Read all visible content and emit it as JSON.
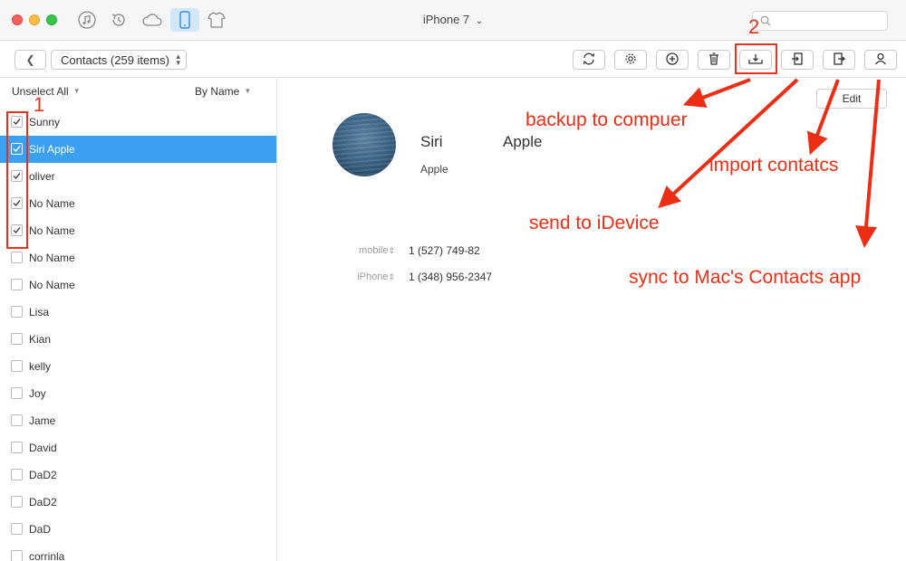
{
  "titlebar": {
    "device": "iPhone 7",
    "device_caret": "⌄",
    "search_placeholder": "",
    "icons": [
      "music-icon",
      "restore-icon",
      "cloud-icon",
      "phone-icon",
      "tshirt-icon"
    ]
  },
  "toolbar": {
    "back_glyph": "❮",
    "category": "Contacts (259 items)",
    "buttons": [
      "refresh-icon",
      "settings-icon",
      "add-icon",
      "delete-icon",
      "backup-to-computer-icon",
      "import-icon",
      "send-to-device-icon",
      "sync-contacts-icon"
    ]
  },
  "list": {
    "unselect_label": "Unselect All",
    "sort_label": "By Name",
    "items": [
      {
        "name": "Sunny",
        "checked": true,
        "selected": false
      },
      {
        "name": "Siri Apple",
        "checked": true,
        "selected": true
      },
      {
        "name": "oliver",
        "checked": true,
        "selected": false
      },
      {
        "name": "No Name",
        "checked": true,
        "selected": false
      },
      {
        "name": "No Name",
        "checked": true,
        "selected": false
      },
      {
        "name": "No Name",
        "checked": false,
        "selected": false
      },
      {
        "name": "No Name",
        "checked": false,
        "selected": false
      },
      {
        "name": "Lisa",
        "checked": false,
        "selected": false
      },
      {
        "name": "Kian",
        "checked": false,
        "selected": false
      },
      {
        "name": "kelly",
        "checked": false,
        "selected": false
      },
      {
        "name": "Joy",
        "checked": false,
        "selected": false
      },
      {
        "name": "Jame",
        "checked": false,
        "selected": false
      },
      {
        "name": "David",
        "checked": false,
        "selected": false
      },
      {
        "name": "DaD2",
        "checked": false,
        "selected": false
      },
      {
        "name": "DaD2",
        "checked": false,
        "selected": false
      },
      {
        "name": "DaD",
        "checked": false,
        "selected": false
      },
      {
        "name": "corrinla",
        "checked": false,
        "selected": false
      }
    ]
  },
  "detail": {
    "edit_label": "Edit",
    "first_name": "Siri",
    "last_name": "Apple",
    "company": "Apple",
    "phones": [
      {
        "label": "mobile",
        "value": "1 (527) 749-82"
      },
      {
        "label": "iPhone",
        "value": "1 (348) 956-2347"
      }
    ]
  },
  "annotations": {
    "step1": "1",
    "step2": "2",
    "backup": "backup to compuer",
    "import": "import contatcs",
    "send": "send to iDevice",
    "sync": "sync to Mac's Contacts app"
  },
  "colors": {
    "selection": "#3ba0f2",
    "annotation": "#ee2e14",
    "active_tab": "#d3e7f8"
  }
}
